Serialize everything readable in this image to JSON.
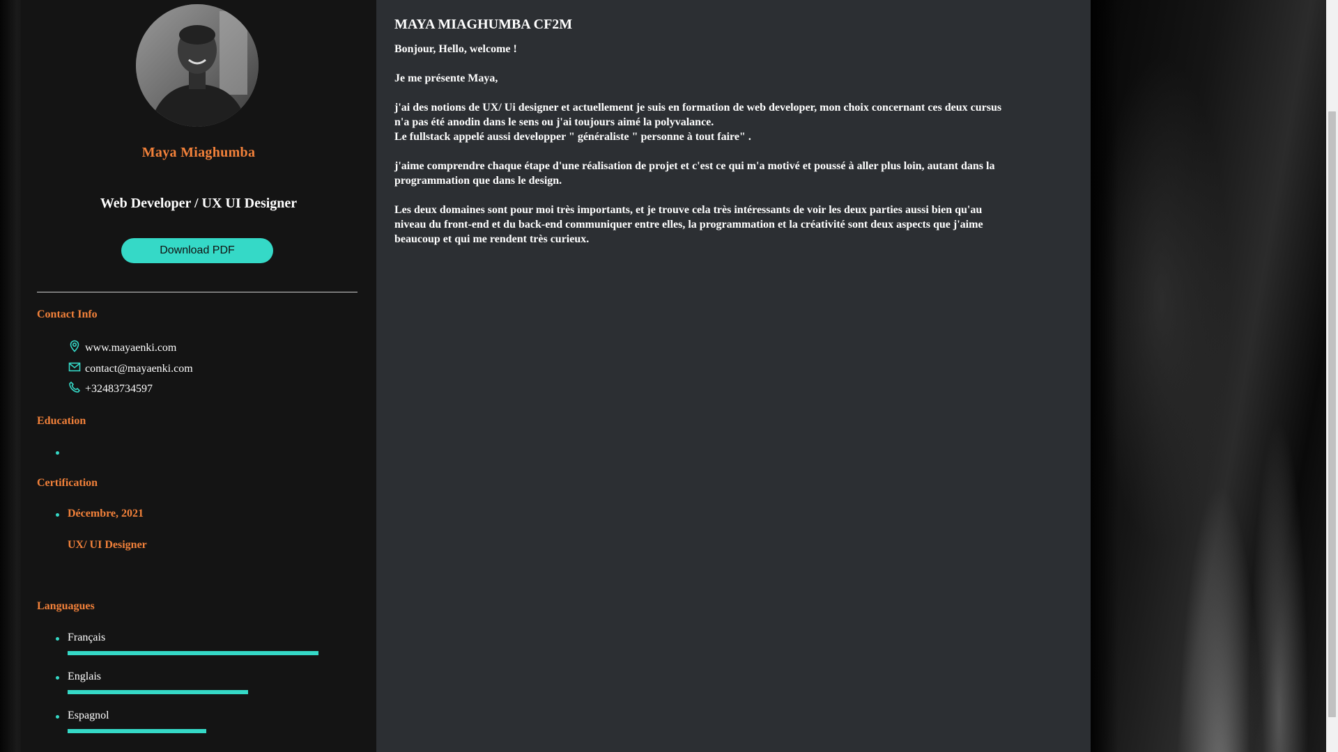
{
  "profile": {
    "name": "Maya Miaghumba",
    "role": "Web Developer / UX UI Designer",
    "download_label": "Download PDF"
  },
  "contact": {
    "title": "Contact Info",
    "items": [
      {
        "icon": "location-pin-icon",
        "text": "www.mayaenki.com"
      },
      {
        "icon": "mail-icon",
        "text": "contact@mayaenki.com"
      },
      {
        "icon": "phone-icon",
        "text": "+32483734597"
      }
    ]
  },
  "education": {
    "title": "Education"
  },
  "certification": {
    "title": "Certification",
    "date": "Décembre, 2021",
    "name": "UX/ UI Designer"
  },
  "languages": {
    "title": "Languagues",
    "items": [
      {
        "label": "Français",
        "level": 0.88
      },
      {
        "label": "Englais",
        "level": 0.63
      },
      {
        "label": "Espagnol",
        "level": 0.49
      }
    ]
  },
  "main": {
    "title": "MAYA MIAGHUMBA CF2M",
    "greeting": "Bonjour, Hello, welcome !",
    "intro": "Je me présente Maya,",
    "p1_line1": "j'ai des notions de UX/ Ui designer et actuellement je suis en formation de web developer, mon choix concernant ces deux cursus",
    "p1_line2": "n'a pas été anodin dans le sens ou j'ai toujours aimé la polyvalance.",
    "p1_line3": "Le fullstack appelé aussi developper \" généraliste \" personne à tout faire\" .",
    "p2_line1": "j'aime comprendre chaque étape d'une réalisation de projet et c'est ce qui m'a motivé et poussé à aller plus loin, autant dans la",
    "p2_line2": "programmation que dans le design.",
    "p3_line1": "Les deux domaines sont pour moi très importants, et je trouve cela très intéressants de voir les deux parties aussi bien qu'au",
    "p3_line2": "niveau du front-end et du back-end communiquer entre elles, la programmation et la créativité sont deux aspects que j'aime",
    "p3_line3": "beaucoup et qui me rendent très curieux."
  },
  "colors": {
    "accent": "#35d9c7",
    "heading": "#f2813a",
    "sidebar_bg": "#141414",
    "main_bg": "#2c2f33"
  }
}
